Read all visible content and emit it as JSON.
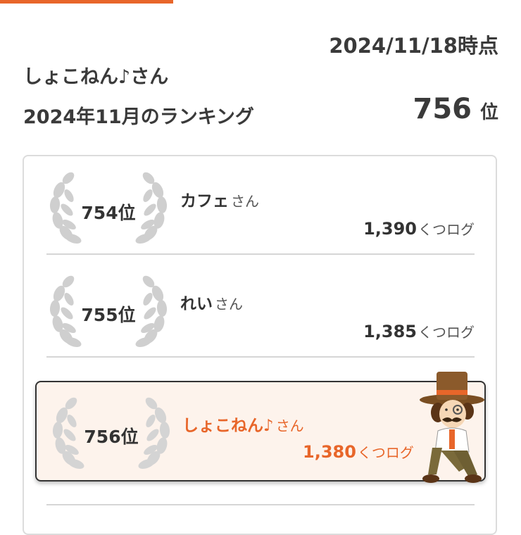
{
  "header": {
    "date_label": "2024/11/18時点",
    "user_name": "しょこねん♪さん",
    "ranking_caption": "2024年11月のランキング",
    "my_rank": "756",
    "my_rank_suffix": "位"
  },
  "ranking": [
    {
      "rank": "754位",
      "name": "カフェ",
      "honorific": "さん",
      "score": "1,390",
      "unit": "くつログ",
      "is_me": false
    },
    {
      "rank": "755位",
      "name": "れい",
      "honorific": "さん",
      "score": "1,385",
      "unit": "くつログ",
      "is_me": false
    },
    {
      "rank": "756位",
      "name": "しょこねん♪",
      "honorific": "さん",
      "score": "1,380",
      "unit": "くつログ",
      "is_me": true
    }
  ],
  "colors": {
    "accent": "#e8662a",
    "highlight_bg": "#fdf3ec",
    "text": "#333333",
    "laurel": "#cfcfcf"
  },
  "icons": {
    "laurel": "laurel-wreath-icon",
    "mascot": "detective-mascot-illustration"
  }
}
